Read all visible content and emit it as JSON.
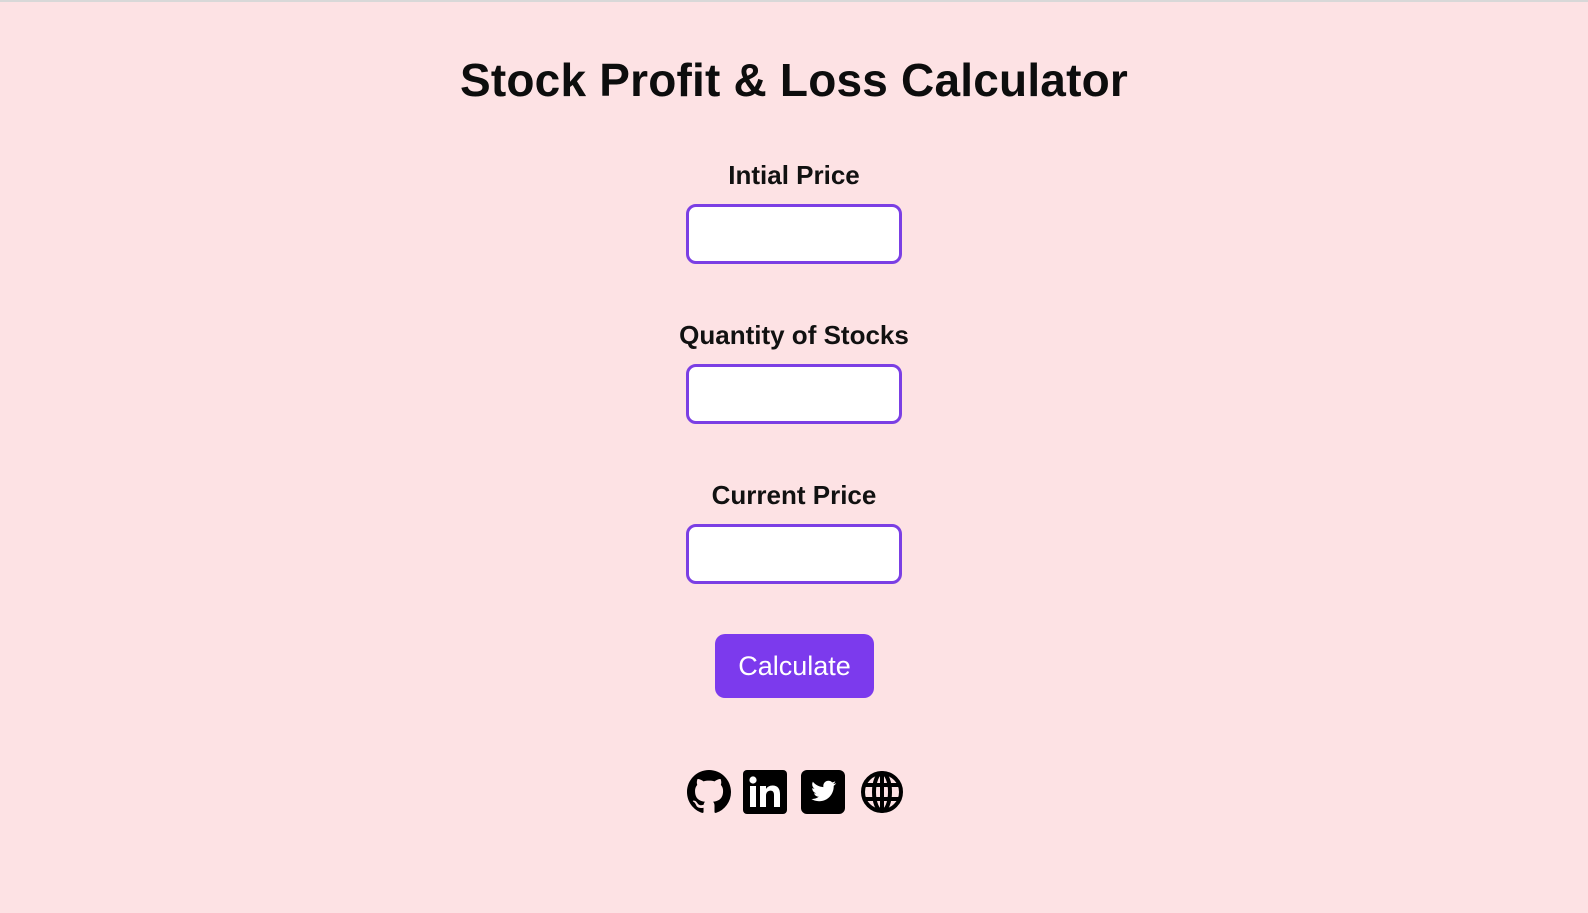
{
  "header": {
    "title": "Stock Profit & Loss Calculator"
  },
  "form": {
    "initial_price": {
      "label": "Intial Price",
      "value": "",
      "placeholder": ""
    },
    "quantity": {
      "label": "Quantity of Stocks",
      "value": "",
      "placeholder": ""
    },
    "current_price": {
      "label": "Current Price",
      "value": "",
      "placeholder": ""
    },
    "calculate_label": "Calculate"
  },
  "footer": {
    "social_icons": [
      "github-icon",
      "linkedin-icon",
      "twitter-icon",
      "globe-icon"
    ]
  },
  "colors": {
    "background": "#fde2e4",
    "accent": "#7c3aed",
    "input_border": "#7b3fe4",
    "text": "#111111"
  }
}
